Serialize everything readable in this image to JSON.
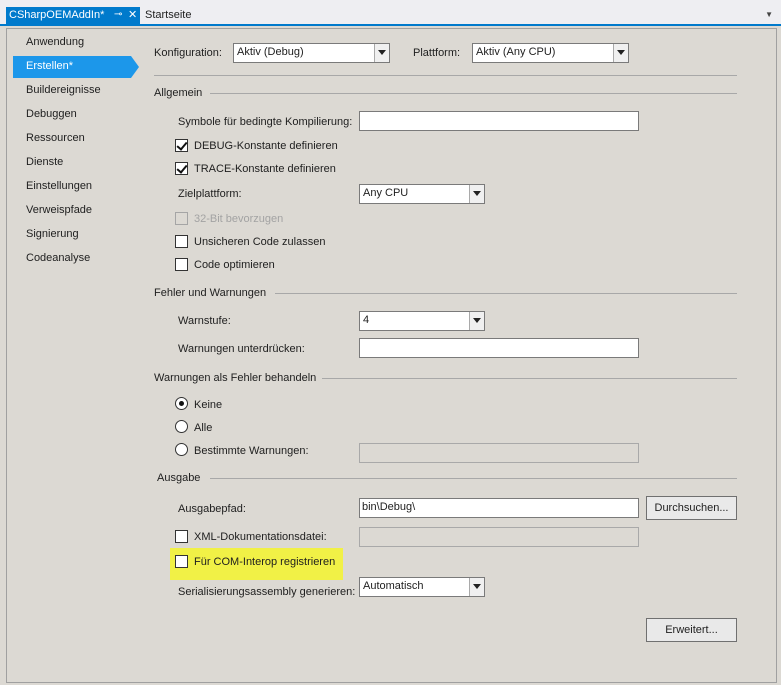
{
  "tabs": {
    "active_label": "CSharpOEMAddIn*",
    "pin_glyph": "⊸",
    "close_glyph": "✕",
    "inactive_label": "Startseite",
    "overflow_glyph": "▼"
  },
  "sidebar": {
    "items": [
      {
        "label": "Anwendung"
      },
      {
        "label": "Erstellen*"
      },
      {
        "label": "Buildereignisse"
      },
      {
        "label": "Debuggen"
      },
      {
        "label": "Ressourcen"
      },
      {
        "label": "Dienste"
      },
      {
        "label": "Einstellungen"
      },
      {
        "label": "Verweispfade"
      },
      {
        "label": "Signierung"
      },
      {
        "label": "Codeanalyse"
      }
    ],
    "active_index": 1
  },
  "config": {
    "konfiguration_label": "Konfiguration:",
    "konfiguration_value": "Aktiv (Debug)",
    "plattform_label": "Plattform:",
    "plattform_value": "Aktiv (Any CPU)"
  },
  "allgemein": {
    "title": "Allgemein",
    "symbols_label": "Symbole für bedingte Kompilierung:",
    "symbols_value": "",
    "debug_label": "DEBUG-Konstante definieren",
    "debug_checked": true,
    "trace_label": "TRACE-Konstante definieren",
    "trace_checked": true,
    "zielplattform_label": "Zielplattform:",
    "zielplattform_value": "Any CPU",
    "prefer32_label": "32-Bit bevorzugen",
    "unsafe_label": "Unsicheren Code zulassen",
    "optimize_label": "Code optimieren"
  },
  "fehler": {
    "title": "Fehler und Warnungen",
    "warnstufe_label": "Warnstufe:",
    "warnstufe_value": "4",
    "suppress_label": "Warnungen unterdrücken:",
    "suppress_value": ""
  },
  "warnings_as_errors": {
    "title": "Warnungen als Fehler behandeln",
    "option_none": "Keine",
    "option_all": "Alle",
    "option_specific": "Bestimmte Warnungen:",
    "selected": "Keine",
    "specific_value": ""
  },
  "ausgabe": {
    "title": "Ausgabe",
    "path_label": "Ausgabepfad:",
    "path_value": "bin\\Debug\\",
    "browse_label": "Durchsuchen...",
    "xmldoc_label": "XML-Dokumentationsdatei:",
    "xmldoc_value": "",
    "com_label": "Für COM-Interop registrieren",
    "serial_label": "Serialisierungsassembly generieren:",
    "serial_value": "Automatisch",
    "advanced_label": "Erweitert..."
  },
  "colors": {
    "tab_active": "#007acc",
    "sidebar_active": "#1c97ea",
    "highlight": "#f1f146",
    "panel_bg": "#dcd9d3"
  }
}
